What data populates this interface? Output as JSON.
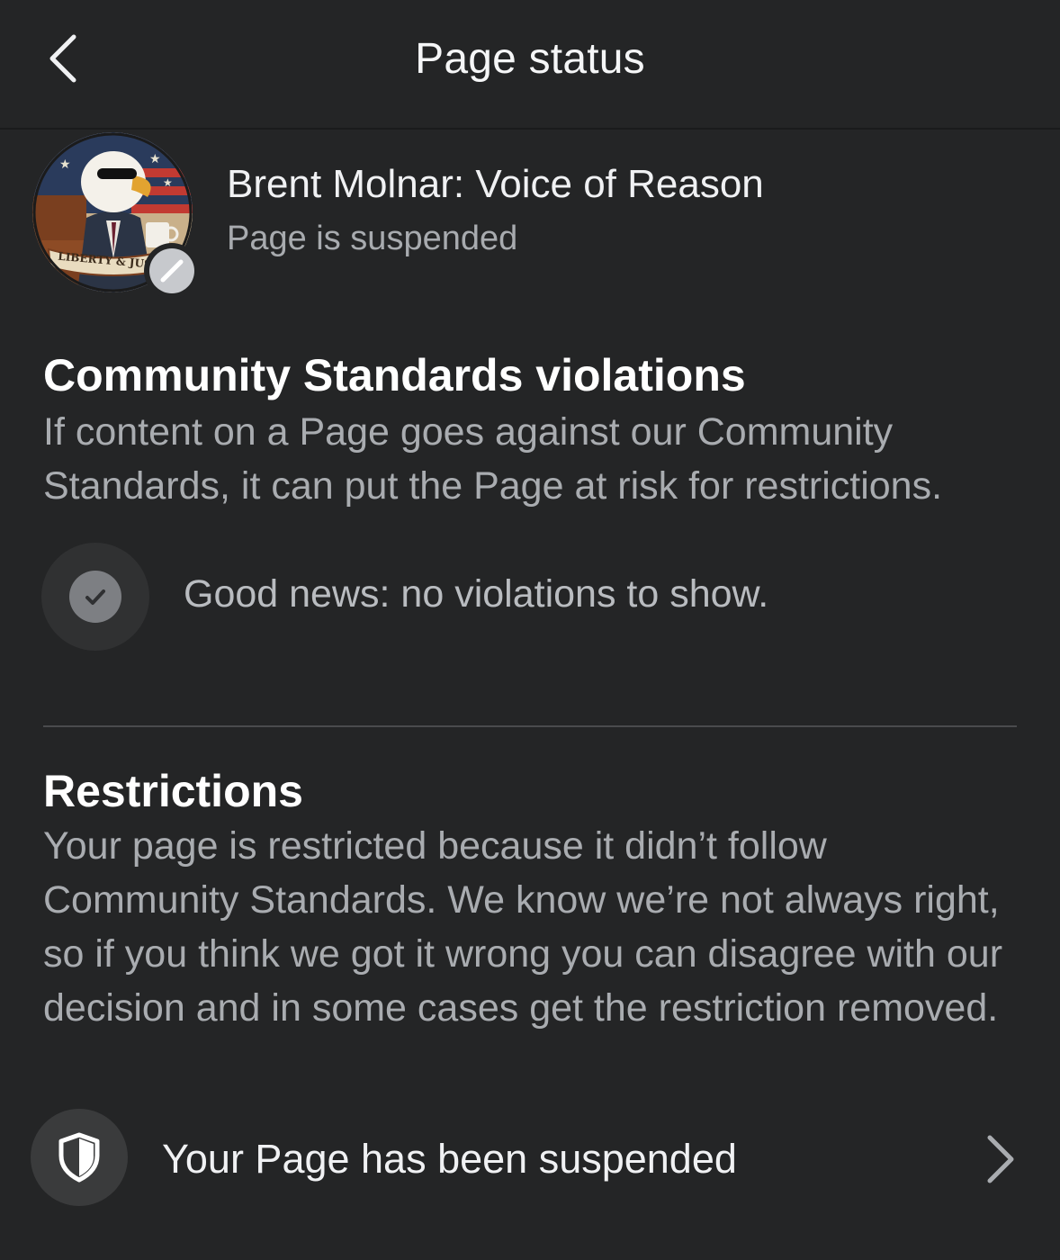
{
  "header": {
    "title": "Page status",
    "back_icon": "chevron-left-icon"
  },
  "profile": {
    "name": "Brent Molnar: Voice of Reason",
    "status": "Page is suspended",
    "avatar_text": "LIBERTY & JUST",
    "badge_icon": "blocked-icon"
  },
  "violations": {
    "title": "Community Standards violations",
    "description": "If content on a Page goes against our Community Standards, it can put the Page at risk for restrictions.",
    "status_icon": "checkmark-icon",
    "status_text": "Good news: no violations to show."
  },
  "restrictions": {
    "title": "Restrictions",
    "description": "Your page is restricted because it didn’t follow Community Standards. We know we’re not always right, so if you think we got it wrong you can disagree with our decision and in some cases get the restriction removed.",
    "item_icon": "shield-icon",
    "item_label": "Your Page has been suspended",
    "item_chevron": "chevron-right-icon"
  },
  "colors": {
    "background": "#242526",
    "primary_text": "#f0f1f3",
    "secondary_text": "#a9acb0"
  }
}
